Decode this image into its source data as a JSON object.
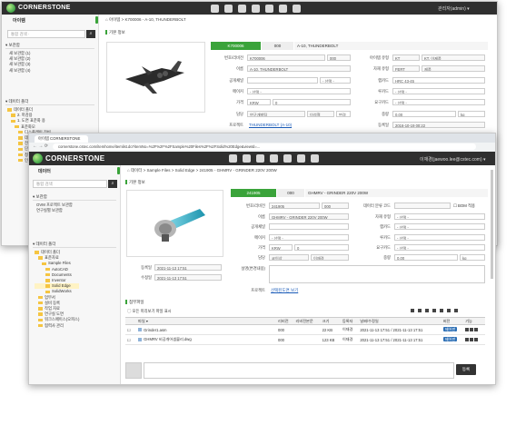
{
  "app": {
    "brand": "CORNERSTONE"
  },
  "back_window": {
    "user": "관리자(admin) ▾",
    "sidebar_title": "아이템",
    "search_placeholder": "통합 검색 ·",
    "bookmark_title": "▾ 보관함",
    "bookmarks": [
      "새 보관함 (1)",
      "새 보관함 (2)",
      "새 보관함 (3)",
      "새 보관함 (4)"
    ],
    "data_folder_title": "▾ 데이터 폴더",
    "folders": [
      "데이터 폴더",
      "2. 마감용",
      "1. 도면 표준화 용",
      "표준화모",
      "디스플레이 장비",
      "데이터 저장 장비",
      "전원공급 장비",
      "단일 조명",
      "청정 시스템",
      "인테리어 장비"
    ],
    "breadcrumb": "아이템  >  K700006 - A-10, THUNDERBOLT",
    "section": "기본 정보",
    "head": {
      "code": "K700006",
      "rev": "000",
      "name": "A-10, THUNDERBOLT"
    },
    "fields_left": [
      {
        "label": "번호/리비전",
        "value": "K700006",
        "extra": "000"
      },
      {
        "label": "이름",
        "value": "A-10, THUNDERBOLT"
      },
      {
        "label": "공개채널",
        "value": "",
        "extra": "- 선택 -"
      },
      {
        "label": "메이커",
        "value": "- 선택 -"
      },
      {
        "label": "가격",
        "value": "KRW",
        "extra": "0"
      },
      {
        "label": "담당",
        "value": "연구개발팀",
        "extra": "이석철",
        "extra2": "변경"
      }
    ],
    "fields_right": [
      {
        "label": "아이템 유형",
        "value": "KT",
        "extra": "KT, 이제품"
      },
      {
        "label": "자재 유형",
        "value": "FERT",
        "extra": "제품"
      },
      {
        "label": "랩카드",
        "value": "HRC 43-45"
      },
      {
        "label": "루카드",
        "value": "- 선택 -"
      },
      {
        "label": "요구카드",
        "value": "- 선택 -"
      },
      {
        "label": "중량",
        "value": "0.00",
        "extra": "kg"
      },
      {
        "label": "등록일",
        "value": "2016-10-19 00:22"
      },
      {
        "label": "수정일",
        "value": "2016-10-19 00:22"
      }
    ],
    "prototype_label": "프로젝트",
    "prototype_link": "THUNDERBOLT (A-10)",
    "ref_label": "참조 아이템",
    "ref_link": "NONE"
  },
  "browser": {
    "tab_title": "아이템 CORNERSTONE",
    "url": "cornerstone.cstec.com/itemhome/itemlist.do?itemNo=%2F%2F%2FSample%20Files%2F%2FSolid%20Edge&viewId=..."
  },
  "front_window": {
    "user": "이재경(jaewoo.lee@cstec.com) ▾",
    "sidebar_title": "데이터",
    "search_placeholder": "통합 검색",
    "bookmark_title": "▾ 보관함",
    "bookmarks": [
      "OVM 프로젝트 보관함",
      "연구실별 보관함"
    ],
    "data_folder_title": "▾ 데이터 폴더",
    "folders": [
      "데이터 폴더",
      "표준자료",
      "Sample Files",
      "AutoCAD",
      "Documents",
      "Inventor",
      "Solid Edge",
      "SolidWorks",
      "업무서",
      "설비 등록",
      "작업 자료",
      "연구실 도면",
      "워크스페이스(오피스)",
      "협력사 관리"
    ],
    "breadcrumb": "데이터  >  Sample Files  >  Solid Edge  >  241905 - GHMRV - GRINDER 220V 200W",
    "section": "기본 정보",
    "head": {
      "code": "241905",
      "rev": "000",
      "name": "GHMRV - GRINDER 220V 200W"
    },
    "fields_left": [
      {
        "label": "번호/리비전",
        "value": "241905",
        "extra": "000"
      },
      {
        "label": "이름",
        "value": "GHMRV - GRINDER 220V 200W"
      },
      {
        "label": "공개채널",
        "value": ""
      },
      {
        "label": "메이커",
        "value": "- 선택 -"
      },
      {
        "label": "가격",
        "value": "KRW",
        "extra": "0"
      },
      {
        "label": "담당",
        "value": "코이상",
        "extra": "이재경"
      },
      {
        "label": "설명(변경내용)",
        "value": ""
      }
    ],
    "fields_right": [
      {
        "label": "데이터 분류 코드",
        "value": "",
        "extra": "BOM 적용"
      },
      {
        "label": "자재 유형",
        "value": "- 선택 -"
      },
      {
        "label": "랩카드",
        "value": "- 선택 -"
      },
      {
        "label": "루카드",
        "value": "- 선택 -"
      },
      {
        "label": "요구카드",
        "value": "- 선택 -"
      },
      {
        "label": "중량",
        "value": "0.00",
        "extra": "kg"
      }
    ],
    "date_labels": [
      "등록일",
      "수정일"
    ],
    "date_values": [
      "2021-11-13 17:51",
      "2021-11-13 17:51"
    ],
    "prototype_label": "프로젝트",
    "prototype_link": "선택된도면 보기",
    "attachment_title": "첨부파일",
    "show_desc_label": "모든 미리보기 파일 표시",
    "table_headers": [
      "",
      "파일 ▾",
      "리비전",
      "리비전본문",
      "크기",
      "등록자",
      "날짜/수정일",
      "버전",
      "기능"
    ],
    "files": [
      {
        "name": "Grinder1.asm",
        "rev": "000",
        "rev2": "",
        "size": "22 KB",
        "user": "이재경",
        "date": "2021-11-13 17:51 / 2021-11-13 17:51",
        "badge": "제어판"
      },
      {
        "name": "GHMRV 비공개어셈블리.dwg",
        "rev": "000",
        "rev2": "",
        "size": "123 KB",
        "user": "이재경",
        "date": "2021-11-13 17:51 / 2021-11-13 17:51",
        "badge": "제어판"
      }
    ],
    "comment_button": "등록"
  }
}
